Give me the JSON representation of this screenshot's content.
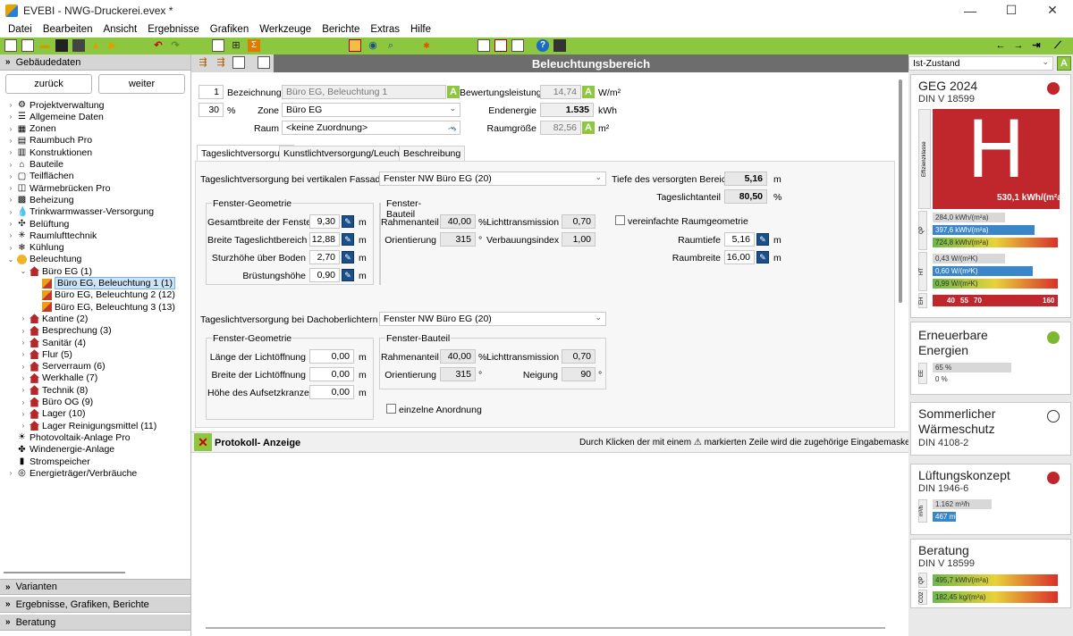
{
  "window": {
    "title": "EVEBI - NWG-Druckerei.evex *",
    "minimize": "—",
    "maximize": "☐",
    "close": "✕"
  },
  "menu": [
    "Datei",
    "Bearbeiten",
    "Ansicht",
    "Ergebnisse",
    "Grafiken",
    "Werkzeuge",
    "Berichte",
    "Extras",
    "Hilfe"
  ],
  "left": {
    "header_top": "Gebäudedaten",
    "back": "zurück",
    "forward": "weiter",
    "tree": [
      {
        "label": "Projektverwaltung",
        "level": 0,
        "icon": "tool"
      },
      {
        "label": "Allgemeine Daten",
        "level": 0,
        "icon": "list"
      },
      {
        "label": "Zonen",
        "level": 0,
        "icon": "zone"
      },
      {
        "label": "Raumbuch Pro",
        "level": 0,
        "icon": "book"
      },
      {
        "label": "Konstruktionen",
        "level": 0,
        "icon": "wall"
      },
      {
        "label": "Bauteile",
        "level": 0,
        "icon": "house-outline"
      },
      {
        "label": "Teilflächen",
        "level": 0,
        "icon": "plan"
      },
      {
        "label": "Wärmebrücken Pro",
        "level": 0,
        "icon": "bridge"
      },
      {
        "label": "Beheizung",
        "level": 0,
        "icon": "heat"
      },
      {
        "label": "Trinkwarmwasser-Versorgung",
        "level": 0,
        "icon": "drop"
      },
      {
        "label": "Belüftung",
        "level": 0,
        "icon": "fan"
      },
      {
        "label": "Raumlufttechnik",
        "level": 0,
        "icon": "air"
      },
      {
        "label": "Kühlung",
        "level": 0,
        "icon": "snow"
      },
      {
        "label": "Beleuchtung",
        "level": 0,
        "icon": "bulb",
        "expanded": true
      },
      {
        "label": "Büro EG (1)",
        "level": 1,
        "icon": "house",
        "expanded": true
      },
      {
        "label": "Büro EG, Beleuchtung 1 (1)",
        "level": 2,
        "icon": "fire",
        "selected": true
      },
      {
        "label": "Büro EG, Beleuchtung 2 (12)",
        "level": 2,
        "icon": "fire"
      },
      {
        "label": "Büro EG, Beleuchtung 3 (13)",
        "level": 2,
        "icon": "fire"
      },
      {
        "label": "Kantine (2)",
        "level": 1,
        "icon": "house"
      },
      {
        "label": "Besprechung (3)",
        "level": 1,
        "icon": "house"
      },
      {
        "label": "Sanitär (4)",
        "level": 1,
        "icon": "house"
      },
      {
        "label": "Flur (5)",
        "level": 1,
        "icon": "house"
      },
      {
        "label": "Serverraum (6)",
        "level": 1,
        "icon": "house"
      },
      {
        "label": "Werkhalle (7)",
        "level": 1,
        "icon": "house"
      },
      {
        "label": "Technik (8)",
        "level": 1,
        "icon": "house"
      },
      {
        "label": "Büro OG (9)",
        "level": 1,
        "icon": "house"
      },
      {
        "label": "Lager (10)",
        "level": 1,
        "icon": "house"
      },
      {
        "label": "Lager Reinigungsmittel (11)",
        "level": 1,
        "icon": "house"
      },
      {
        "label": "Photovoltaik-Anlage Pro",
        "level": 0,
        "icon": "pv"
      },
      {
        "label": "Windenergie-Anlage",
        "level": 0,
        "icon": "wind"
      },
      {
        "label": "Stromspeicher",
        "level": 0,
        "icon": "battery"
      },
      {
        "label": "Energieträger/Verbräuche",
        "level": 0,
        "icon": "meter"
      }
    ],
    "sections": [
      "Varianten",
      "Ergebnisse, Grafiken, Berichte",
      "Beratung"
    ]
  },
  "center": {
    "title": "Beleuchtungsbereich",
    "number": "1",
    "percent": "30",
    "percent_unit": "%",
    "bezeichnung_label": "Bezeichnung",
    "bezeichnung_value": "Büro EG, Beleuchtung 1",
    "zone_label": "Zone",
    "zone_value": "Büro EG",
    "raum_label": "Raum",
    "raum_value": "<keine Zuordnung>",
    "bewertung_label": "Bewertungsleistung",
    "bewertung_value": "14,74",
    "bewertung_unit": "W/m²",
    "endenergie_label": "Endenergie",
    "endenergie_value": "1.535",
    "endenergie_unit": "kWh",
    "raumgroesse_label": "Raumgröße",
    "raumgroesse_value": "82,56",
    "raumgroesse_unit": "m²",
    "badge": "A",
    "tabs": [
      "Tageslichtversorgung",
      "Kunstlichtversorgung/Leuchten",
      "Beschreibung"
    ],
    "vert_label": "Tageslichtversorgung bei vertikalen Fassaden",
    "vert_value": "Fenster NW Büro EG (20)",
    "tiefe_label": "Tiefe des versorgten Bereichs",
    "tiefe_value": "5,16",
    "tiefe_unit": "m",
    "anteil_label": "Tageslichtanteil",
    "anteil_value": "80,50",
    "anteil_unit": "%",
    "fg1_title": "Fenster-Geometrie",
    "fg1": [
      {
        "label": "Gesamtbreite der Fenster",
        "value": "9,30",
        "unit": "m"
      },
      {
        "label": "Breite Tageslichtbereich",
        "value": "12,88",
        "unit": "m"
      },
      {
        "label": "Sturzhöhe über Boden",
        "value": "2,70",
        "unit": "m"
      },
      {
        "label": "Brüstungshöhe",
        "value": "0,90",
        "unit": "m"
      }
    ],
    "fb1_title": "Fenster-Bauteil",
    "fb1": {
      "rahmen_label": "Rahmenanteil",
      "rahmen_value": "40,00",
      "rahmen_unit": "%",
      "licht_label": "Lichttransmission",
      "licht_value": "0,70",
      "orient_label": "Orientierung",
      "orient_value": "315",
      "orient_unit": "°",
      "verbau_label": "Verbauungsindex",
      "verbau_value": "1,00"
    },
    "vereinfacht_label": "vereinfachte Raumgeometrie",
    "raumtiefe_label": "Raumtiefe",
    "raumtiefe_value": "5,16",
    "raumtiefe_unit": "m",
    "raumbreite_label": "Raumbreite",
    "raumbreite_value": "16,00",
    "raumbreite_unit": "m",
    "dach_label": "Tageslichtversorgung bei Dachoberlichtern",
    "dach_value": "Fenster NW Büro EG (20)",
    "fg2_title": "Fenster-Geometrie",
    "fg2": [
      {
        "label": "Länge der Lichtöffnung",
        "value": "0,00",
        "unit": "m"
      },
      {
        "label": "Breite der Lichtöffnung",
        "value": "0,00",
        "unit": "m"
      },
      {
        "label": "Höhe des Aufsetzkranzes",
        "value": "0,00",
        "unit": "m"
      }
    ],
    "fb2_title": "Fenster-Bauteil",
    "fb2": {
      "rahmen_label": "Rahmenanteil",
      "rahmen_value": "40,00",
      "rahmen_unit": "%",
      "licht_label": "Lichttransmission",
      "licht_value": "0,70",
      "orient_label": "Orientierung",
      "orient_value": "315",
      "orient_unit": "°",
      "neigung_label": "Neigung",
      "neigung_value": "90",
      "neigung_unit": "°"
    },
    "einzeln_label": "einzelne Anordnung",
    "protokoll_label": "Protokoll- Anzeige",
    "protokoll_hint": "Durch Klicken der mit einem ⚠ markierten Zeile wird die zugehörige Eingabemaske geöffnet."
  },
  "right": {
    "state": "Ist-Zustand",
    "geg": {
      "title": "GEG 2024",
      "sub": "DIN V 18599",
      "big": "H",
      "value": "530,1 kWh/(m²a)",
      "side_label": "Effizienzklasse",
      "q_bars": [
        {
          "text": "284,0 kWh/(m²a)",
          "color": "#d8d8d8",
          "frac": 0.58
        },
        {
          "text": "397,6 kWh/(m²a)",
          "color": "#3a86c8",
          "frac": 0.82
        },
        {
          "text": "724,8 kWh/(m²a)",
          "color": "grad",
          "frac": 1.0
        }
      ],
      "h_bars": [
        {
          "text": "0,43 W/(m²K)",
          "color": "#d8d8d8",
          "frac": 0.58
        },
        {
          "text": "0,60 W/(m²K)",
          "color": "#3a86c8",
          "frac": 0.8
        },
        {
          "text": "0,99 W/(m²K)",
          "color": "grad",
          "frac": 1.0
        }
      ],
      "q_label": "QP",
      "h_label": "HT",
      "e_label": "EH",
      "eh_ticks": [
        "40",
        "55",
        "70",
        "160"
      ],
      "status_color": "#c0272d"
    },
    "ee": {
      "title": "Erneuerbare Energien",
      "status_color": "#7cb82f",
      "label": "EE",
      "bars": [
        {
          "text": "65 %",
          "frac": 0.7
        },
        {
          "text": "0 %",
          "frac": 0.0
        }
      ]
    },
    "sw": {
      "title": "Sommerlicher Wärmeschutz",
      "sub": "DIN 4108-2",
      "status_color": "#ffffff"
    },
    "lk": {
      "title": "Lüftungskonzept",
      "sub": "DIN 1946-6",
      "status_color": "#c0272d",
      "label": "m³/h",
      "bars": [
        {
          "text": "1.162 m³/h",
          "color": "#d8d8d8",
          "frac": 0.75
        },
        {
          "text": "467 m³/h",
          "color": "#3a86c8",
          "frac": 0.3
        }
      ]
    },
    "ber": {
      "title": "Beratung",
      "sub": "DIN V 18599",
      "bars": [
        {
          "text": "495,7 kWh/(m²a)",
          "frac": 1.0
        },
        {
          "text": "182,45 kg/(m²a)",
          "frac": 1.0
        }
      ],
      "labels": [
        "QP",
        "CO2"
      ]
    }
  }
}
